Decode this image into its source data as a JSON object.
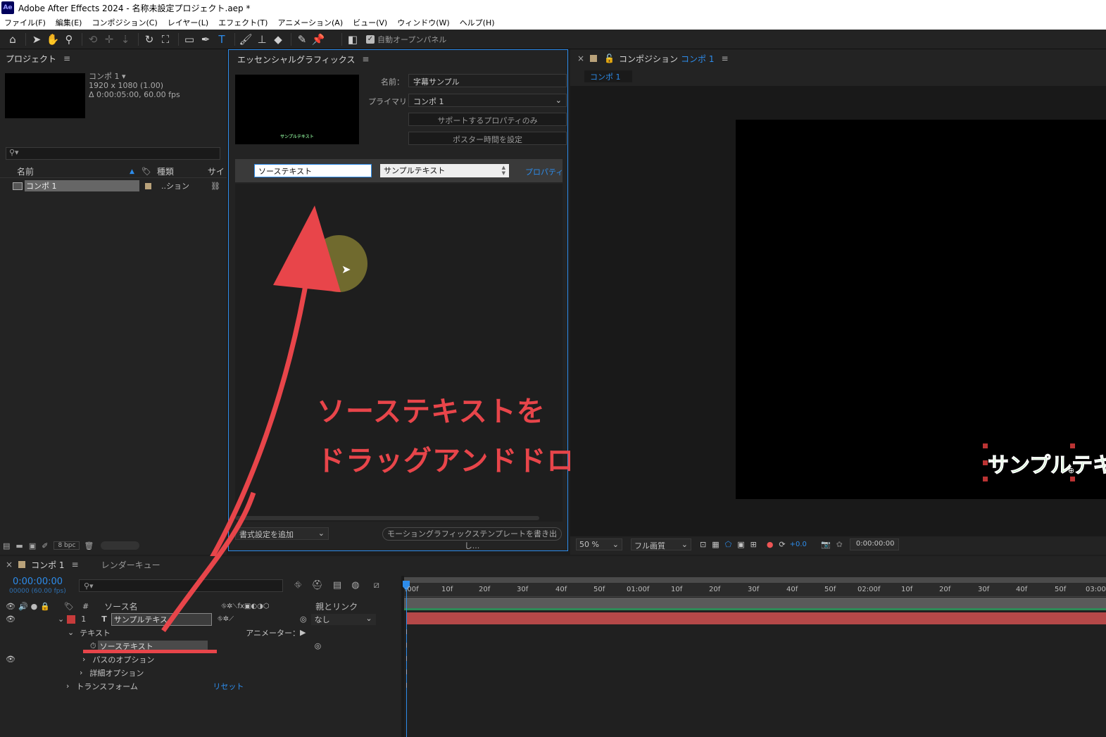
{
  "window": {
    "logo": "Ae",
    "title": "Adobe After Effects 2024 - 名称未設定プロジェクト.aep *"
  },
  "menu": [
    "ファイル(F)",
    "編集(E)",
    "コンポジション(C)",
    "レイヤー(L)",
    "エフェクト(T)",
    "アニメーション(A)",
    "ビュー(V)",
    "ウィンドウ(W)",
    "ヘルプ(H)"
  ],
  "toolbar": {
    "auto_open_label": "自動オープンパネル"
  },
  "project": {
    "title": "プロジェクト",
    "comp_name": "コンポ 1 ▾",
    "comp_res": "1920 x 1080 (1.00)",
    "comp_dur": "Δ 0:00:05:00, 60.00 fps",
    "search_placeholder": "",
    "col_name": "名前",
    "col_type": "種類",
    "col_size": "サイ",
    "item_name": "コンポ 1",
    "item_type": "..ション",
    "bpc": "8 bpc"
  },
  "essential": {
    "title": "エッセンシャルグラフィックス",
    "preview_text": "サンプルテキスト",
    "name_label": "名前：",
    "name_value": "字幕サンプル",
    "primary_label": "プライマリ：",
    "primary_value": "コンポ 1",
    "btn_supported": "サポートするプロパティのみ",
    "btn_poster": "ポスター時間を設定",
    "prop_name": "ソーステキスト",
    "prop_value": "サンプルテキスト",
    "prop_link": "プロパティを",
    "add_format": "書式設定を追加",
    "export_btn": "モーショングラフィックステンプレートを書き出し..."
  },
  "annotation": {
    "line1": "ソーステキストを",
    "line2": "ドラッグアンドドロップ",
    "color": "#e8454a"
  },
  "composition": {
    "tab_label": "コンポジション",
    "tab_name": "コンポ 1",
    "subtab": "コンポ 1",
    "canvas_text": "サンプルテキ",
    "zoom": "50 %",
    "quality": "フル画質",
    "exposure": "+0.0",
    "timecode": "0:00:00:00"
  },
  "timeline": {
    "tab_name": "コンポ 1",
    "render_queue": "レンダーキュー",
    "timecode": "0:00:00:00",
    "frames": "00000 (60.00 fps)",
    "col_source": "ソース名",
    "col_parent": "親とリンク",
    "layer_num": "1",
    "layer_type": "T",
    "layer_name": "サンプルテキス",
    "parent_value": "なし",
    "text_group": "テキスト",
    "animator": "アニメーター：",
    "source_text": "ソーステキスト",
    "path_options": "パスのオプション",
    "more_options": "詳細オプション",
    "transform": "トランスフォーム",
    "reset": "リセット",
    "ruler": [
      ":00f",
      "10f",
      "20f",
      "30f",
      "40f",
      "50f",
      "01:00f",
      "10f",
      "20f",
      "30f",
      "40f",
      "50f",
      "02:00f",
      "10f",
      "20f",
      "30f",
      "40f",
      "50f",
      "03:00"
    ]
  }
}
